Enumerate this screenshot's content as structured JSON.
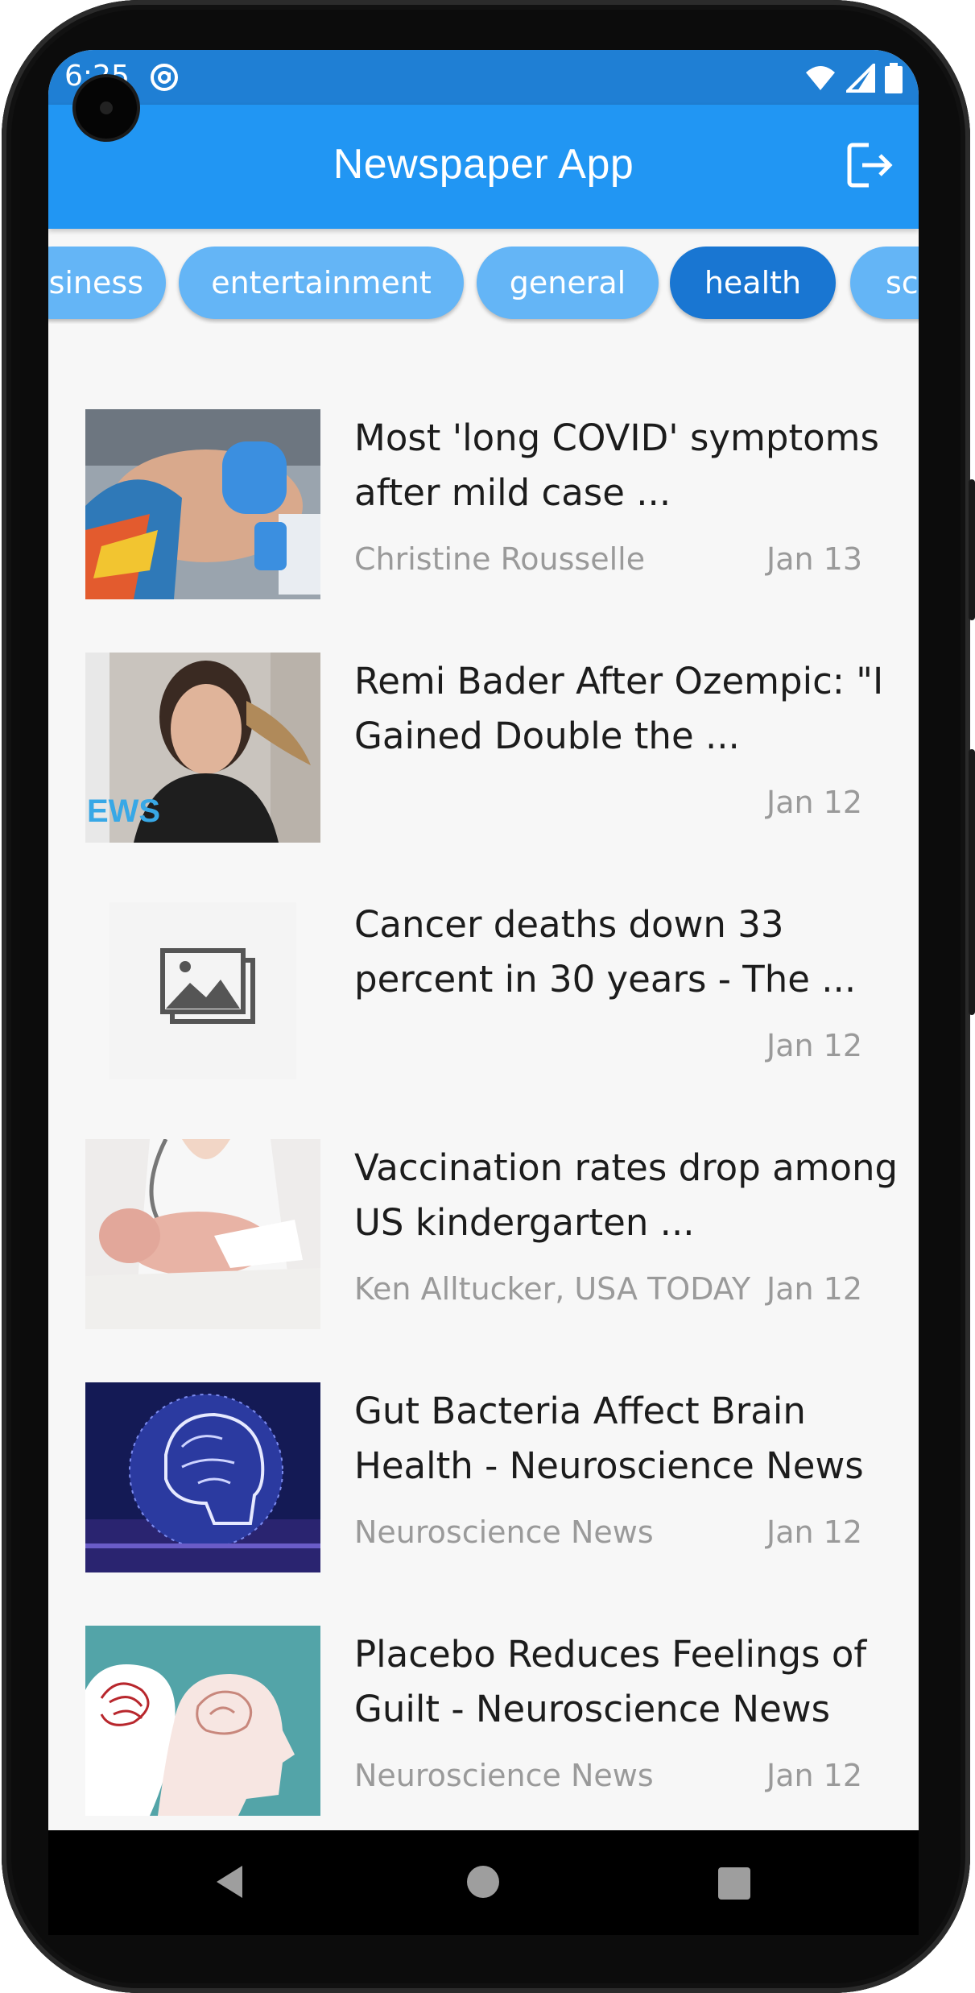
{
  "status_bar": {
    "time": "6:25"
  },
  "app_bar": {
    "title": "Newspaper App",
    "logout_icon": "logout-icon"
  },
  "categories": {
    "items": [
      "business",
      "entertainment",
      "general",
      "health",
      "science"
    ],
    "visible_labels": [
      "siness",
      "entertainment",
      "general",
      "health",
      "sci"
    ],
    "selected": "health"
  },
  "articles": [
    {
      "headline": "Most 'long COVID' symptoms after mild case ...",
      "source": "Christine Rousselle",
      "date": "Jan 13",
      "image": "covid-test-photo"
    },
    {
      "headline": "Remi Bader After Ozempic: \"I Gained Double the ...",
      "source": "",
      "date": "Jan 12",
      "image": "portrait-photo"
    },
    {
      "headline": "Cancer deaths down 33 percent in 30 years - The ...",
      "source": "",
      "date": "Jan 12",
      "image": "image-placeholder-icon"
    },
    {
      "headline": "Vaccination rates drop among US kindergarten ...",
      "source": "Ken Alltucker, USA TODAY",
      "date": "Jan 12",
      "image": "baby-photo"
    },
    {
      "headline": "Gut Bacteria Affect Brain Health - Neuroscience News",
      "source": "Neuroscience News",
      "date": "Jan 12",
      "image": "brain-network-illustration"
    },
    {
      "headline": "Placebo Reduces Feelings of Guilt - Neuroscience News",
      "source": "Neuroscience News",
      "date": "Jan 12",
      "image": "brain-heads-illustration"
    }
  ],
  "colors": {
    "app_bar": "#2196f3",
    "chip": "#64b5f6",
    "chip_selected": "#1976d2",
    "background": "#f7f7f7"
  }
}
